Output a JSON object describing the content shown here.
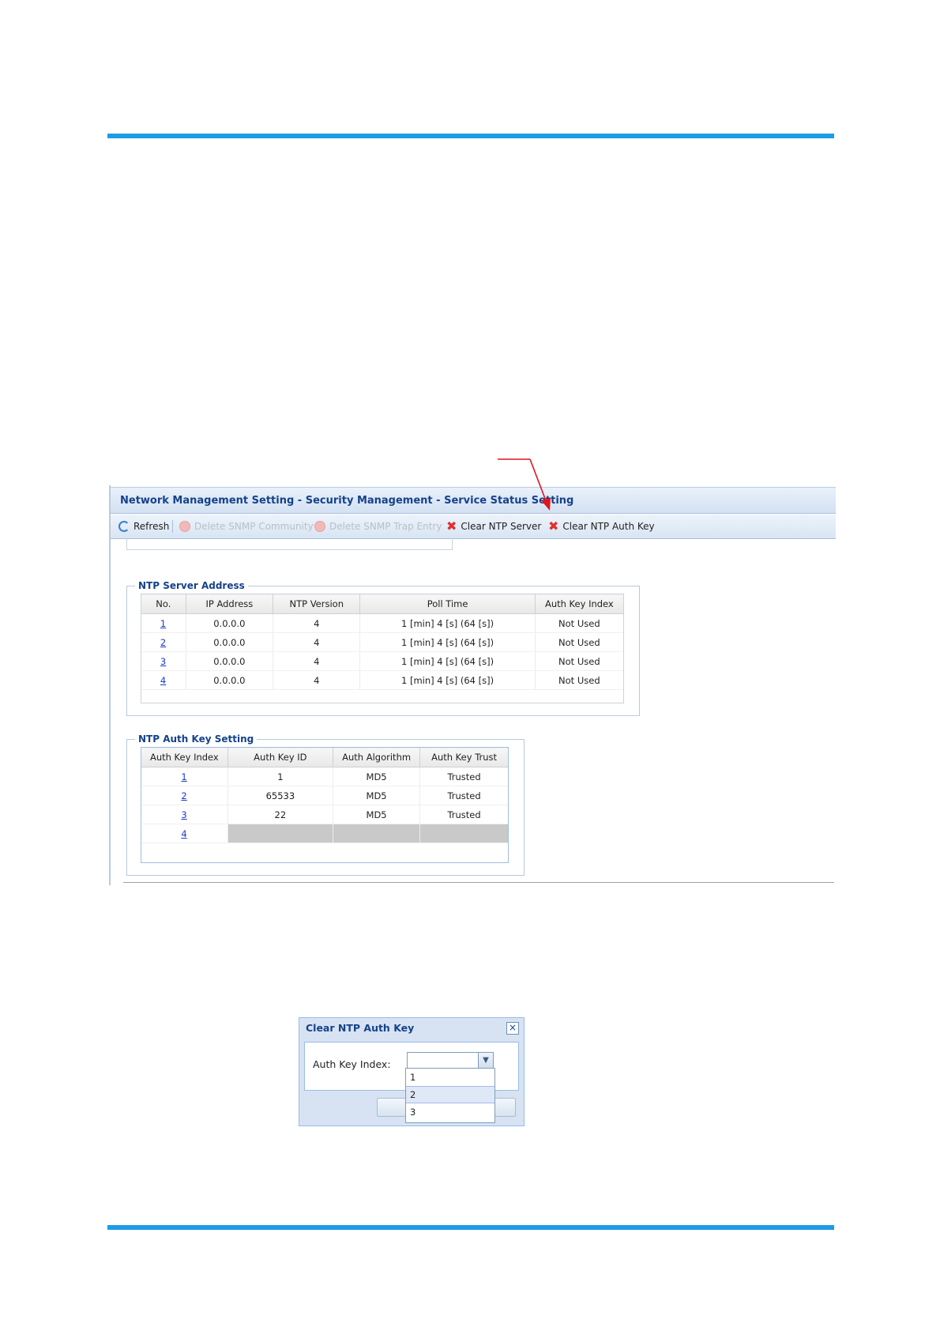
{
  "panel": {
    "title": "Network Management Setting - Security Management - Service Status Setting",
    "toolbar": {
      "refresh": "Refresh",
      "delete_snmp_community": "Delete SNMP Community",
      "delete_snmp_trap_entry": "Delete SNMP Trap Entry",
      "clear_ntp_server": "Clear NTP Server",
      "clear_ntp_auth_key": "Clear NTP Auth Key"
    }
  },
  "ntp_server": {
    "legend": "NTP Server Address",
    "columns": [
      "No.",
      "IP Address",
      "NTP Version",
      "Poll Time",
      "Auth Key Index"
    ],
    "rows": [
      {
        "no": "1",
        "ip": "0.0.0.0",
        "version": "4",
        "poll": "1 [min] 4 [s] (64 [s])",
        "key_index": "Not Used"
      },
      {
        "no": "2",
        "ip": "0.0.0.0",
        "version": "4",
        "poll": "1 [min] 4 [s] (64 [s])",
        "key_index": "Not Used"
      },
      {
        "no": "3",
        "ip": "0.0.0.0",
        "version": "4",
        "poll": "1 [min] 4 [s] (64 [s])",
        "key_index": "Not Used"
      },
      {
        "no": "4",
        "ip": "0.0.0.0",
        "version": "4",
        "poll": "1 [min] 4 [s] (64 [s])",
        "key_index": "Not Used"
      }
    ]
  },
  "ntp_auth": {
    "legend": "NTP Auth Key Setting",
    "columns": [
      "Auth Key Index",
      "Auth Key ID",
      "Auth Algorithm",
      "Auth Key Trust"
    ],
    "rows": [
      {
        "index": "1",
        "key_id": "1",
        "algorithm": "MD5",
        "trust": "Trusted"
      },
      {
        "index": "2",
        "key_id": "65533",
        "algorithm": "MD5",
        "trust": "Trusted"
      },
      {
        "index": "3",
        "key_id": "22",
        "algorithm": "MD5",
        "trust": "Trusted"
      },
      {
        "index": "4",
        "key_id": "",
        "algorithm": "",
        "trust": ""
      }
    ]
  },
  "dialog": {
    "title": "Clear NTP Auth Key",
    "close_icon": "×",
    "label": "Auth Key Index:",
    "value": "",
    "options": [
      "1",
      "2",
      "3"
    ],
    "highlighted_option": "2"
  },
  "colors": {
    "accent_rule": "#1e9be6",
    "title_text": "#15428b",
    "arrow": "#e0141e"
  }
}
